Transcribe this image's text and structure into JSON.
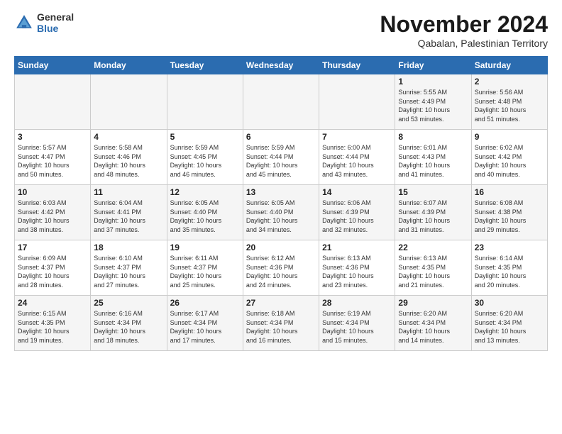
{
  "logo": {
    "line1": "General",
    "line2": "Blue"
  },
  "title": "November 2024",
  "location": "Qabalan, Palestinian Territory",
  "days_header": [
    "Sunday",
    "Monday",
    "Tuesday",
    "Wednesday",
    "Thursday",
    "Friday",
    "Saturday"
  ],
  "weeks": [
    [
      {
        "day": "",
        "content": ""
      },
      {
        "day": "",
        "content": ""
      },
      {
        "day": "",
        "content": ""
      },
      {
        "day": "",
        "content": ""
      },
      {
        "day": "",
        "content": ""
      },
      {
        "day": "1",
        "content": "Sunrise: 5:55 AM\nSunset: 4:49 PM\nDaylight: 10 hours\nand 53 minutes."
      },
      {
        "day": "2",
        "content": "Sunrise: 5:56 AM\nSunset: 4:48 PM\nDaylight: 10 hours\nand 51 minutes."
      }
    ],
    [
      {
        "day": "3",
        "content": "Sunrise: 5:57 AM\nSunset: 4:47 PM\nDaylight: 10 hours\nand 50 minutes."
      },
      {
        "day": "4",
        "content": "Sunrise: 5:58 AM\nSunset: 4:46 PM\nDaylight: 10 hours\nand 48 minutes."
      },
      {
        "day": "5",
        "content": "Sunrise: 5:59 AM\nSunset: 4:45 PM\nDaylight: 10 hours\nand 46 minutes."
      },
      {
        "day": "6",
        "content": "Sunrise: 5:59 AM\nSunset: 4:44 PM\nDaylight: 10 hours\nand 45 minutes."
      },
      {
        "day": "7",
        "content": "Sunrise: 6:00 AM\nSunset: 4:44 PM\nDaylight: 10 hours\nand 43 minutes."
      },
      {
        "day": "8",
        "content": "Sunrise: 6:01 AM\nSunset: 4:43 PM\nDaylight: 10 hours\nand 41 minutes."
      },
      {
        "day": "9",
        "content": "Sunrise: 6:02 AM\nSunset: 4:42 PM\nDaylight: 10 hours\nand 40 minutes."
      }
    ],
    [
      {
        "day": "10",
        "content": "Sunrise: 6:03 AM\nSunset: 4:42 PM\nDaylight: 10 hours\nand 38 minutes."
      },
      {
        "day": "11",
        "content": "Sunrise: 6:04 AM\nSunset: 4:41 PM\nDaylight: 10 hours\nand 37 minutes."
      },
      {
        "day": "12",
        "content": "Sunrise: 6:05 AM\nSunset: 4:40 PM\nDaylight: 10 hours\nand 35 minutes."
      },
      {
        "day": "13",
        "content": "Sunrise: 6:05 AM\nSunset: 4:40 PM\nDaylight: 10 hours\nand 34 minutes."
      },
      {
        "day": "14",
        "content": "Sunrise: 6:06 AM\nSunset: 4:39 PM\nDaylight: 10 hours\nand 32 minutes."
      },
      {
        "day": "15",
        "content": "Sunrise: 6:07 AM\nSunset: 4:39 PM\nDaylight: 10 hours\nand 31 minutes."
      },
      {
        "day": "16",
        "content": "Sunrise: 6:08 AM\nSunset: 4:38 PM\nDaylight: 10 hours\nand 29 minutes."
      }
    ],
    [
      {
        "day": "17",
        "content": "Sunrise: 6:09 AM\nSunset: 4:37 PM\nDaylight: 10 hours\nand 28 minutes."
      },
      {
        "day": "18",
        "content": "Sunrise: 6:10 AM\nSunset: 4:37 PM\nDaylight: 10 hours\nand 27 minutes."
      },
      {
        "day": "19",
        "content": "Sunrise: 6:11 AM\nSunset: 4:37 PM\nDaylight: 10 hours\nand 25 minutes."
      },
      {
        "day": "20",
        "content": "Sunrise: 6:12 AM\nSunset: 4:36 PM\nDaylight: 10 hours\nand 24 minutes."
      },
      {
        "day": "21",
        "content": "Sunrise: 6:13 AM\nSunset: 4:36 PM\nDaylight: 10 hours\nand 23 minutes."
      },
      {
        "day": "22",
        "content": "Sunrise: 6:13 AM\nSunset: 4:35 PM\nDaylight: 10 hours\nand 21 minutes."
      },
      {
        "day": "23",
        "content": "Sunrise: 6:14 AM\nSunset: 4:35 PM\nDaylight: 10 hours\nand 20 minutes."
      }
    ],
    [
      {
        "day": "24",
        "content": "Sunrise: 6:15 AM\nSunset: 4:35 PM\nDaylight: 10 hours\nand 19 minutes."
      },
      {
        "day": "25",
        "content": "Sunrise: 6:16 AM\nSunset: 4:34 PM\nDaylight: 10 hours\nand 18 minutes."
      },
      {
        "day": "26",
        "content": "Sunrise: 6:17 AM\nSunset: 4:34 PM\nDaylight: 10 hours\nand 17 minutes."
      },
      {
        "day": "27",
        "content": "Sunrise: 6:18 AM\nSunset: 4:34 PM\nDaylight: 10 hours\nand 16 minutes."
      },
      {
        "day": "28",
        "content": "Sunrise: 6:19 AM\nSunset: 4:34 PM\nDaylight: 10 hours\nand 15 minutes."
      },
      {
        "day": "29",
        "content": "Sunrise: 6:20 AM\nSunset: 4:34 PM\nDaylight: 10 hours\nand 14 minutes."
      },
      {
        "day": "30",
        "content": "Sunrise: 6:20 AM\nSunset: 4:34 PM\nDaylight: 10 hours\nand 13 minutes."
      }
    ]
  ]
}
